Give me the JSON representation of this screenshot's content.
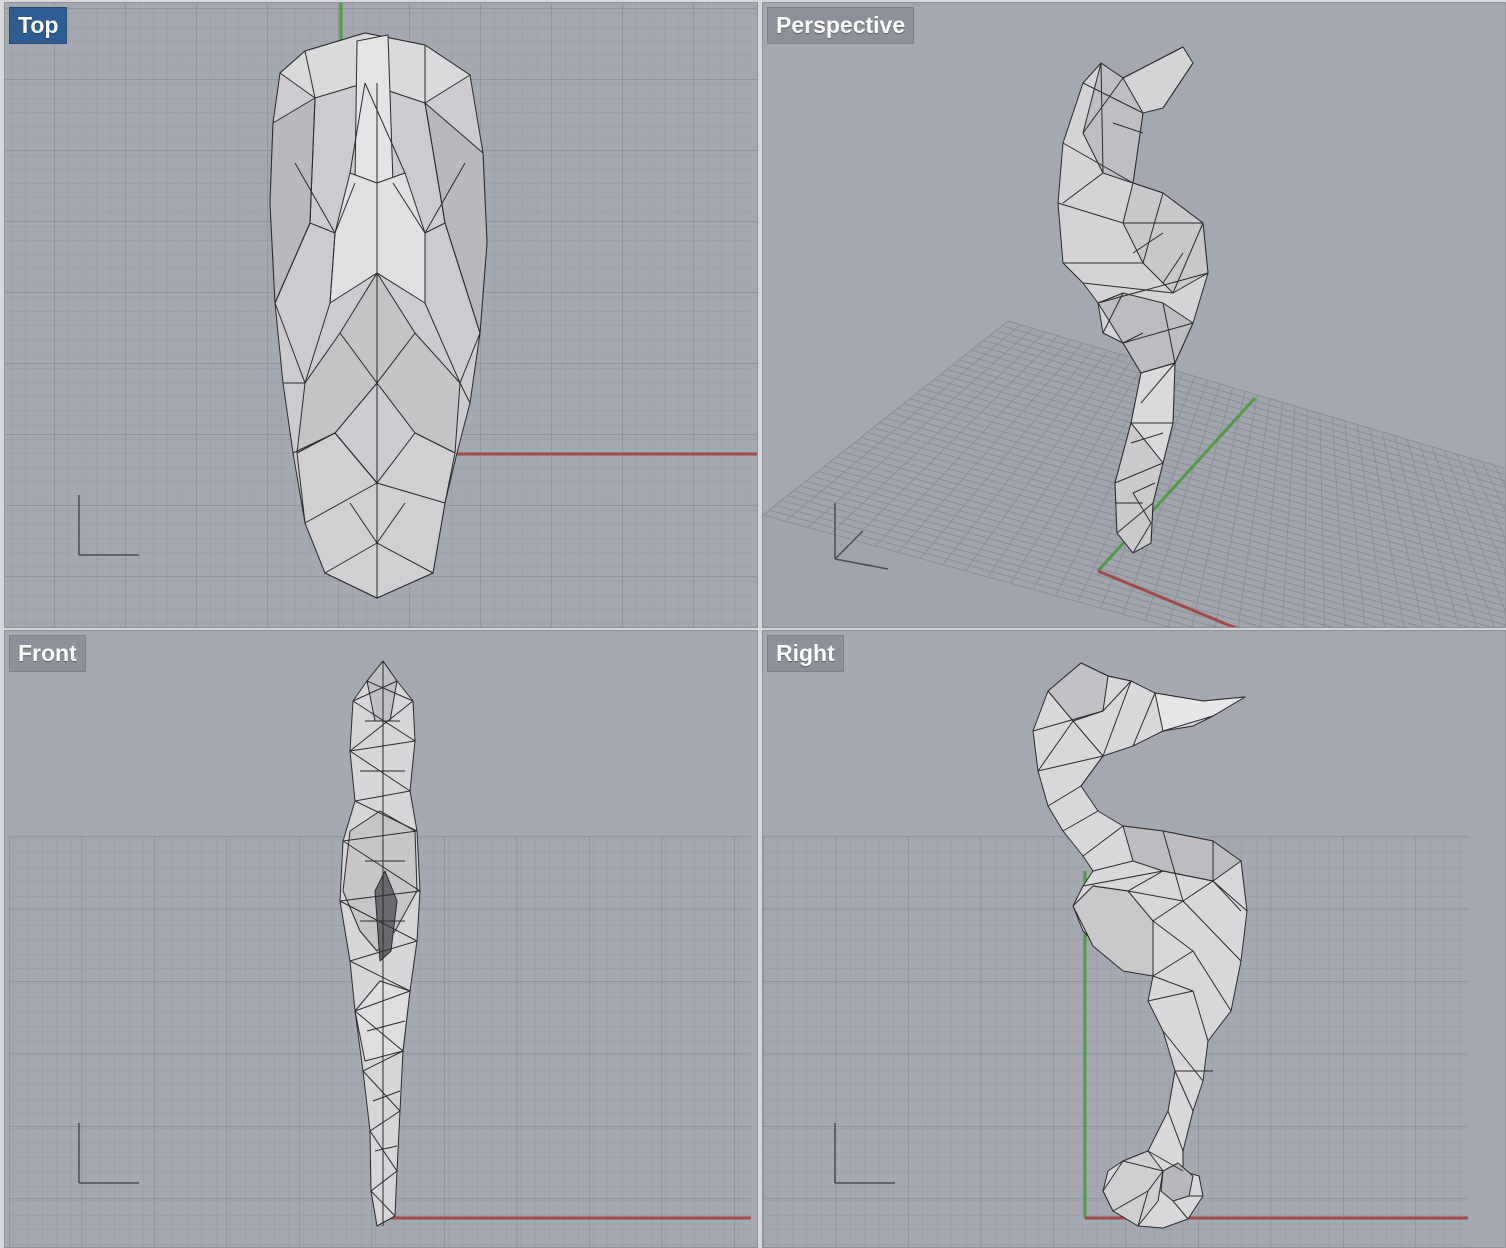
{
  "viewports": {
    "top": {
      "label": "Top",
      "active": true
    },
    "perspective": {
      "label": "Perspective",
      "active": false
    },
    "front": {
      "label": "Front",
      "active": false
    },
    "right": {
      "label": "Right",
      "active": false
    }
  },
  "colors": {
    "viewport_bg": "#a4a9b1",
    "active_label_bg": "#2d5d92",
    "label_bg": "#8c9098",
    "grid_minor": "#969ba3",
    "grid_major": "#858a93",
    "x_axis": "#a3494a",
    "y_axis": "#4f9a46",
    "mesh_fill": "#d4d4d6",
    "mesh_edge": "#2a2a2c"
  },
  "model": {
    "name": "seahorse-mesh",
    "display_mode": "wireframe-shaded"
  }
}
